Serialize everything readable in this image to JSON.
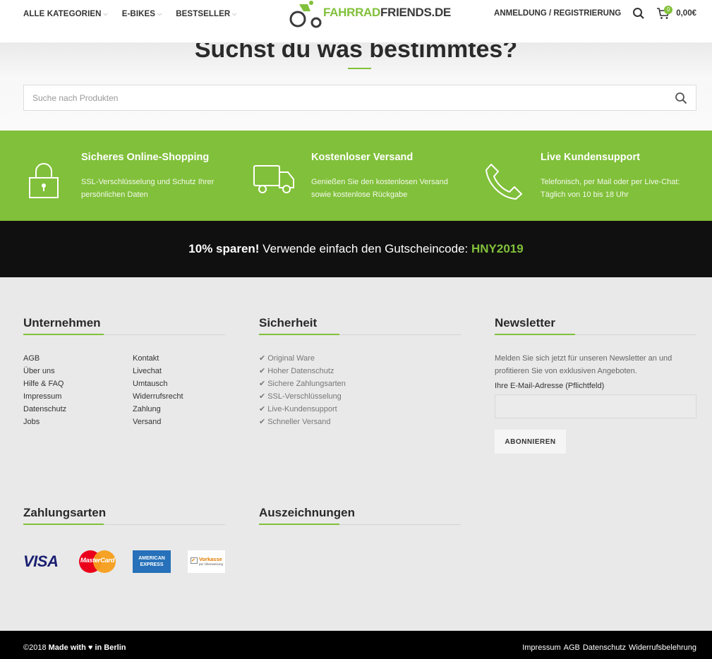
{
  "header": {
    "nav": [
      {
        "label": "ALLE KATEGORIEN",
        "has_dropdown": true
      },
      {
        "label": "E-BIKES",
        "has_dropdown": true
      },
      {
        "label": "BESTSELLER",
        "has_dropdown": true
      }
    ],
    "logo": {
      "part1": "FAHRRAD",
      "part2": "FRIENDS.DE"
    },
    "login_label": "ANMELDUNG / REGISTRIERUNG",
    "cart_count": "0",
    "cart_total": "0,00€"
  },
  "search": {
    "title": "Suchst du was bestimmtes?",
    "placeholder": "Suche nach Produkten"
  },
  "features": [
    {
      "icon": "lock-icon",
      "title": "Sicheres Online-Shopping",
      "text": "SSL-Verschlüsselung und Schutz Ihrer persönlichen Daten"
    },
    {
      "icon": "truck-icon",
      "title": "Kostenloser Versand",
      "text": "Genießen Sie den kostenlosen Versand sowie kostenlose Rückgabe"
    },
    {
      "icon": "phone-icon",
      "title": "Live Kundensupport",
      "text": "Telefonisch, per Mail oder per Live-Chat: Täglich von 10 bis 18 Uhr"
    }
  ],
  "promo": {
    "bold": "10% sparen!",
    "text": " Verwende einfach den Gutscheincode: ",
    "code": "HNY2019"
  },
  "footer": {
    "company": {
      "title": "Unternehmen",
      "col1": [
        "AGB",
        "Über uns",
        "Hilfe & FAQ",
        "Impressum",
        "Datenschutz",
        "Jobs"
      ],
      "col2": [
        "Kontakt",
        "Livechat",
        "Umtausch",
        "Widerrufsrecht",
        "Zahlung",
        "Versand"
      ]
    },
    "security": {
      "title": "Sicherheit",
      "items": [
        "Original Ware",
        "Hoher Datenschutz",
        "Sichere Zahlungsarten",
        "SSL-Verschlüsselung",
        "Live-Kundensupport",
        "Schneller Versand"
      ]
    },
    "newsletter": {
      "title": "Newsletter",
      "text": "Melden Sie sich jetzt für unseren Newsletter an und profitieren Sie von exklusiven Angeboten.",
      "label": "Ihre E-Mail-Adresse (Pflichtfeld)",
      "button": "ABONNIEREN"
    },
    "payments": {
      "title": "Zahlungsarten",
      "methods": [
        {
          "name": "visa-logo",
          "label": "VISA"
        },
        {
          "name": "mastercard-logo",
          "label": "MasterCard"
        },
        {
          "name": "amex-logo",
          "label": "AMERICAN EXPRESS"
        },
        {
          "name": "vorkasse-logo",
          "label": "Vorkasse",
          "sub": "per Überweisung"
        }
      ]
    },
    "awards": {
      "title": "Auszeichnungen"
    }
  },
  "bottom": {
    "copyright": "©2018",
    "made_with": "Made with",
    "heart": "♥",
    "in_berlin": "in Berlin",
    "links": [
      "Impressum",
      "AGB",
      "Datenschutz",
      "Widerrufsbelehrung"
    ]
  },
  "colors": {
    "accent": "#81c03a",
    "promo_bg": "#101010",
    "footer_bg": "#e9e9e9"
  }
}
